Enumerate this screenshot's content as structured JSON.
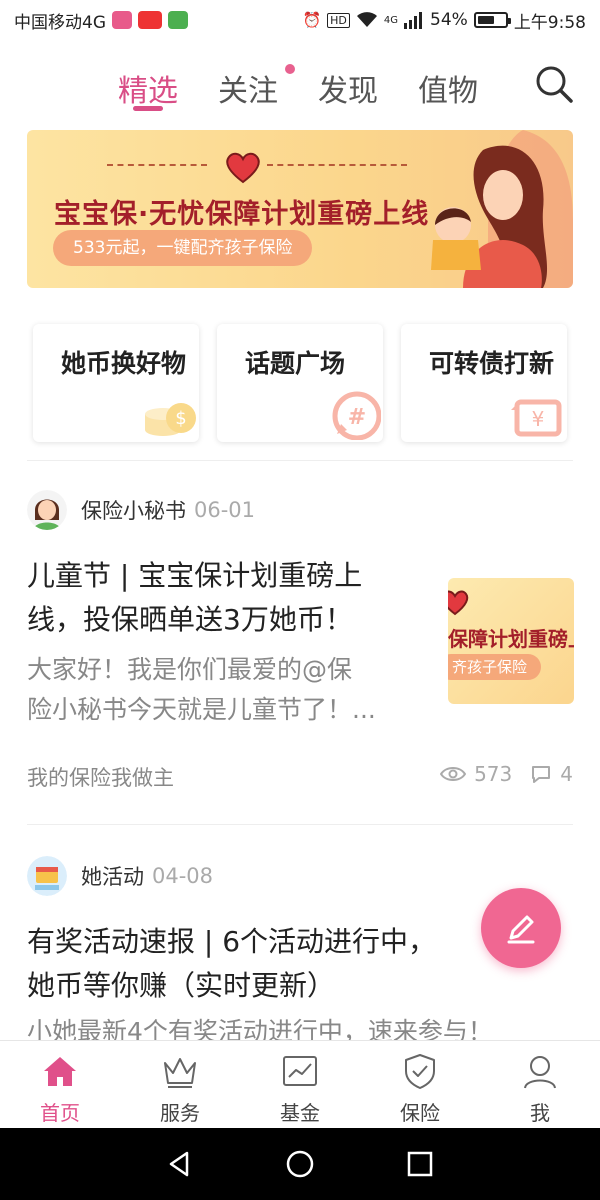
{
  "statusbar": {
    "carrier": "中国移动4G",
    "battery_text": "54%",
    "battery_level": 0.54,
    "time": "上午9:58",
    "hd_label": "HD",
    "network_label": "4G"
  },
  "top_tabs": [
    {
      "label": "精选",
      "active": true
    },
    {
      "label": "关注",
      "active": false,
      "has_dot": true
    },
    {
      "label": "发现",
      "active": false
    },
    {
      "label": "值物",
      "active": false
    }
  ],
  "banner": {
    "title": "宝宝保·无忧保障计划重磅上线",
    "pill": "533元起，一键配齐孩子保险"
  },
  "quick_cards": [
    {
      "label": "她币换好物",
      "icon": "coins-icon"
    },
    {
      "label": "话题广场",
      "icon": "hashtag-bubble-icon"
    },
    {
      "label": "可转债打新",
      "icon": "yen-exchange-icon"
    }
  ],
  "posts": [
    {
      "author": "保险小秘书",
      "date": "06-01",
      "title_lines": [
        "儿童节 | 宝宝保计划重磅上",
        "线，投保晒单送3万她币！"
      ],
      "excerpt_lines": [
        "大家好！我是你们最爱的@保",
        "险小秘书今天就是儿童节了！..."
      ],
      "thumb_text": "保障计划重磅上",
      "thumb_pill": "齐孩子保险",
      "tag": "我的保险我做主",
      "views": "573",
      "comments": "4"
    },
    {
      "author": "她活动",
      "date": "04-08",
      "title_lines": [
        "有奖活动速报 | 6个活动进行中，",
        "她币等你赚（实时更新）"
      ],
      "excerpt_lines": [
        "小她最新4个有奖活动进行中，速来参与！"
      ]
    }
  ],
  "bottom_nav": [
    {
      "label": "首页",
      "icon": "home-icon",
      "active": true
    },
    {
      "label": "服务",
      "icon": "crown-icon",
      "active": false
    },
    {
      "label": "基金",
      "icon": "chart-icon",
      "active": false
    },
    {
      "label": "保险",
      "icon": "shield-icon",
      "active": false
    },
    {
      "label": "我",
      "icon": "user-icon",
      "active": false
    }
  ],
  "colors": {
    "accent": "#d94e86",
    "fab": "#f06792",
    "banner_title": "#a31f2a"
  }
}
